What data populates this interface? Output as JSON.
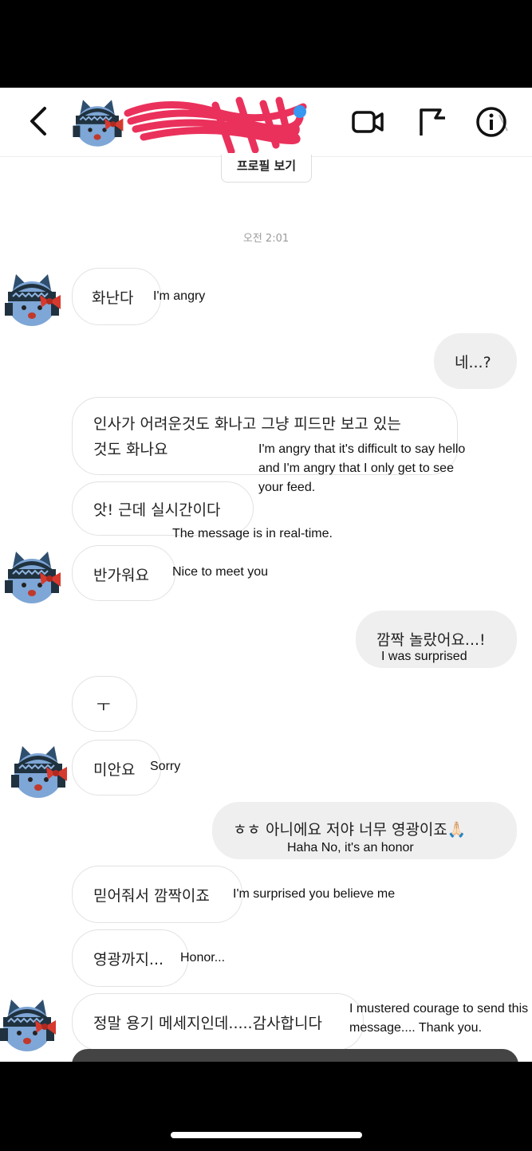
{
  "header": {
    "back_icon": "chevron-left-icon",
    "video_icon": "video-camera-icon",
    "flag_icon": "flag-icon",
    "info_icon": "info-icon"
  },
  "profile_button": "프로필 보기",
  "timestamp": "오전 2:01",
  "messages": [
    {
      "text": "화난다",
      "translation": "I'm angry"
    },
    {
      "text": "네...?"
    },
    {
      "text": "인사가 어려운것도 화나고 그냥 피드만 보고 있는 것도 화나요",
      "line1": "인사가 어려운것도 화나고 그냥 피드만 보고 있는",
      "line2": "것도 화나요",
      "translation": "I'm angry that it's difficult to say hello and I'm angry that I only get to see your feed."
    },
    {
      "text": "앗! 근데 실시간이다",
      "translation": "The message is in real-time."
    },
    {
      "text": "반가워요",
      "translation": "Nice to meet you"
    },
    {
      "text": "깜짝 놀랐어요...!",
      "translation": "I was surprised"
    },
    {
      "text": "ㅜ"
    },
    {
      "text": "미안요",
      "translation": "Sorry"
    },
    {
      "text": "ㅎㅎ 아니에요 저야 너무 영광이죠🙏🏻",
      "translation": "Haha No, it's an honor"
    },
    {
      "text": "믿어줘서 깜짝이죠",
      "translation": "I'm surprised you believe me"
    },
    {
      "text": "영광까지...",
      "translation": "Honor..."
    },
    {
      "text": "정말 용기 메세지인데.....감사합니다",
      "translation": "I mustered courage to send this message.... Thank you."
    }
  ]
}
